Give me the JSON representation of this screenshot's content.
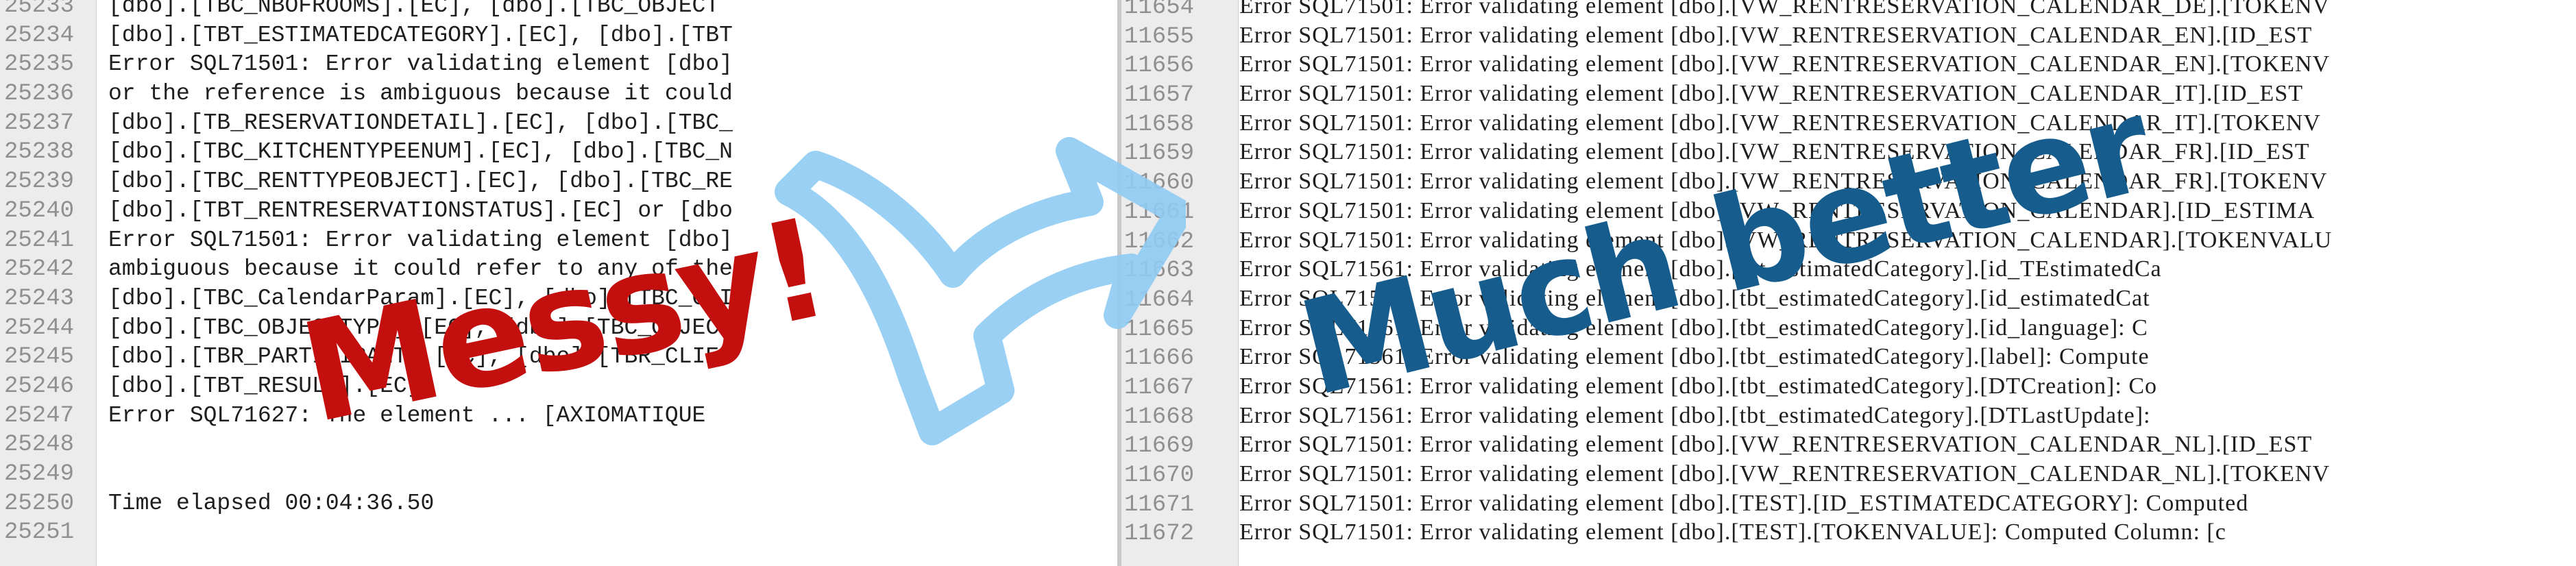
{
  "left_panel": {
    "lines": [
      {
        "n": "25233",
        "t": "[dbo].[TBC_NBOFROOMS].[EC], [dbo].[TBC_OBJECT"
      },
      {
        "n": "25234",
        "t": "[dbo].[TBT_ESTIMATEDCATEGORY].[EC], [dbo].[TBT"
      },
      {
        "n": "25235",
        "t": "Error SQL71501: Error validating element [dbo]"
      },
      {
        "n": "25236",
        "t": "or the reference is ambiguous because it could"
      },
      {
        "n": "25237",
        "t": "[dbo].[TB_RESERVATIONDETAIL].[EC], [dbo].[TBC_"
      },
      {
        "n": "25238",
        "t": "[dbo].[TBC_KITCHENTYPEENUM].[EC], [dbo].[TBC_N"
      },
      {
        "n": "25239",
        "t": "[dbo].[TBC_RENTTYPEOBJECT].[EC], [dbo].[TBC_RE"
      },
      {
        "n": "25240",
        "t": "[dbo].[TBT_RENTRESERVATIONSTATUS].[EC] or [dbo"
      },
      {
        "n": "25241",
        "t": "Error SQL71501: Error validating element [dbo]"
      },
      {
        "n": "25242",
        "t": "ambiguous because it could refer to any of the"
      },
      {
        "n": "25243",
        "t": "[dbo].[TBC_CalendarParam].[EC], [dbo].[TBC_CLI"
      },
      {
        "n": "25244",
        "t": "[dbo].[TBC_OBJECTTYPE].[EC], [dbo].[TBC_OBJECT"
      },
      {
        "n": "25245",
        "t": "[dbo].[TBR_PARTICIPANT].[EC], [dbo].[TBR_CLIEN"
      },
      {
        "n": "25246",
        "t": "[dbo].[TBT_RESULT].[EC]."
      },
      {
        "n": "25247",
        "t": "Error SQL71627: The element ... [AXIOMATIQUE"
      },
      {
        "n": "25248",
        "t": ""
      },
      {
        "n": "25249",
        "t": ""
      },
      {
        "n": "25250",
        "t": "Time elapsed 00:04:36.50"
      },
      {
        "n": "25251",
        "t": ""
      }
    ]
  },
  "right_panel": {
    "lines": [
      {
        "n": "11654",
        "t": "Error SQL71501: Error validating element [dbo].[VW_RENTRESERVATION_CALENDAR_DE].[TOKENV"
      },
      {
        "n": "11655",
        "t": "Error SQL71501: Error validating element [dbo].[VW_RENTRESERVATION_CALENDAR_EN].[ID_EST"
      },
      {
        "n": "11656",
        "t": "Error SQL71501: Error validating element [dbo].[VW_RENTRESERVATION_CALENDAR_EN].[TOKENV"
      },
      {
        "n": "11657",
        "t": "Error SQL71501: Error validating element [dbo].[VW_RENTRESERVATION_CALENDAR_IT].[ID_EST"
      },
      {
        "n": "11658",
        "t": "Error SQL71501: Error validating element [dbo].[VW_RENTRESERVATION_CALENDAR_IT].[TOKENV"
      },
      {
        "n": "11659",
        "t": "Error SQL71501: Error validating element [dbo].[VW_RENTRESERVATION_CALENDAR_FR].[ID_EST"
      },
      {
        "n": "11660",
        "t": "Error SQL71501: Error validating element [dbo].[VW_RENTRESERVATION_CALENDAR_FR].[TOKENV"
      },
      {
        "n": "11661",
        "t": "Error SQL71501: Error validating element [dbo].[VW_RENTRESERVATION_CALENDAR].[ID_ESTIMA"
      },
      {
        "n": "11662",
        "t": "Error SQL71501: Error validating element [dbo].[VW_RENTRESERVATION_CALENDAR].[TOKENVALU"
      },
      {
        "n": "11663",
        "t": "Error SQL71561: Error validating element [dbo].[tbt_estimatedCategory].[id_TEstimatedCa"
      },
      {
        "n": "11664",
        "t": "Error SQL71561: Error validating element [dbo].[tbt_estimatedCategory].[id_estimatedCat"
      },
      {
        "n": "11665",
        "t": "Error SQL71561: Error validating element [dbo].[tbt_estimatedCategory].[id_language]: C"
      },
      {
        "n": "11666",
        "t": "Error SQL71561: Error validating element [dbo].[tbt_estimatedCategory].[label]: Compute"
      },
      {
        "n": "11667",
        "t": "Error SQL71561: Error validating element [dbo].[tbt_estimatedCategory].[DTCreation]: Co"
      },
      {
        "n": "11668",
        "t": "Error SQL71561: Error validating element [dbo].[tbt_estimatedCategory].[DTLastUpdate]: "
      },
      {
        "n": "11669",
        "t": "Error SQL71501: Error validating element [dbo].[VW_RENTRESERVATION_CALENDAR_NL].[ID_EST"
      },
      {
        "n": "11670",
        "t": "Error SQL71501: Error validating element [dbo].[VW_RENTRESERVATION_CALENDAR_NL].[TOKENV"
      },
      {
        "n": "11671",
        "t": "Error SQL71501: Error validating element [dbo].[TEST].[ID_ESTIMATEDCATEGORY]: Computed"
      },
      {
        "n": "11672",
        "t": "Error SQL71501: Error validating element [dbo].[TEST].[TOKENVALUE]: Computed Column: [c"
      }
    ]
  },
  "annotations": {
    "messy": "Messy!",
    "better": "Much better"
  },
  "colors": {
    "messy": "#c40f0f",
    "better": "#165d8d",
    "arrow": "#8ecbf3"
  },
  "icons": {
    "arrow": "right-arrow-icon"
  }
}
